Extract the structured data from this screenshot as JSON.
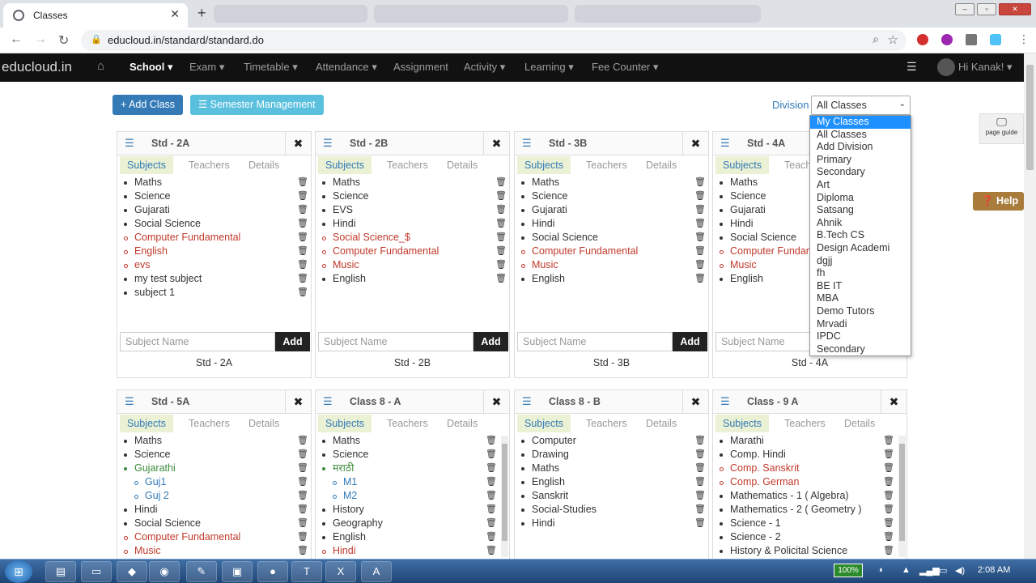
{
  "browser": {
    "tab_title": "Classes",
    "url": "educloud.in/standard/standard.do"
  },
  "navbar": {
    "brand": "educloud.in",
    "items": [
      "School ▾",
      "Exam ▾",
      "Timetable ▾",
      "Attendance ▾",
      "Assignment",
      "Activity ▾",
      "Learning ▾",
      "Fee Counter ▾"
    ],
    "user": "Hi Kanak! ▾"
  },
  "actions": {
    "add_class": "+ Add Class",
    "semester": "☰ Semester Management",
    "division_label": "Division",
    "division_value": "All Classes"
  },
  "division_options": [
    "My Classes",
    "All Classes",
    "Add Division",
    "Primary",
    "Secondary",
    "Art",
    "Diploma",
    "Satsang",
    "Ahnik",
    "B.Tech CS",
    "Design Academi",
    "dgjj",
    "fh",
    "BE IT",
    "MBA",
    "Demo Tutors",
    "Mrvadi",
    "IPDC",
    "Secondary"
  ],
  "page_guide": "page guide",
  "help": "Help",
  "card_tabs": [
    "Subjects",
    "Teachers",
    "Details"
  ],
  "subject_placeholder": "Subject Name",
  "add_label": "Add",
  "cards": [
    {
      "name": "Std - 2A",
      "footer": "Std - 2A",
      "subjects": [
        {
          "t": "Maths",
          "k": "n"
        },
        {
          "t": "Science",
          "k": "n"
        },
        {
          "t": "Gujarati",
          "k": "n"
        },
        {
          "t": "Social Science",
          "k": "n"
        },
        {
          "t": "Computer Fundamental",
          "k": "o"
        },
        {
          "t": "English",
          "k": "o"
        },
        {
          "t": "evs",
          "k": "o"
        },
        {
          "t": "my test subject",
          "k": "n"
        },
        {
          "t": "subject 1",
          "k": "n"
        }
      ]
    },
    {
      "name": "Std - 2B",
      "footer": "Std - 2B",
      "subjects": [
        {
          "t": "Maths",
          "k": "n"
        },
        {
          "t": "Science",
          "k": "n"
        },
        {
          "t": "EVS",
          "k": "n"
        },
        {
          "t": "Hindi",
          "k": "n"
        },
        {
          "t": "Social Science_$",
          "k": "o"
        },
        {
          "t": "Computer Fundamental",
          "k": "o"
        },
        {
          "t": "Music",
          "k": "o"
        },
        {
          "t": "English",
          "k": "n"
        }
      ]
    },
    {
      "name": "Std - 3B",
      "footer": "Std - 3B",
      "subjects": [
        {
          "t": "Maths",
          "k": "n"
        },
        {
          "t": "Science",
          "k": "n"
        },
        {
          "t": "Gujarati",
          "k": "n"
        },
        {
          "t": "Hindi",
          "k": "n"
        },
        {
          "t": "Social Science",
          "k": "n"
        },
        {
          "t": "Computer Fundamental",
          "k": "o"
        },
        {
          "t": "Music",
          "k": "o"
        },
        {
          "t": "English",
          "k": "n"
        }
      ]
    },
    {
      "name": "Std - 4A",
      "footer": "Std - 4A",
      "subjects": [
        {
          "t": "Maths",
          "k": "n"
        },
        {
          "t": "Science",
          "k": "n"
        },
        {
          "t": "Gujarati",
          "k": "n"
        },
        {
          "t": "Hindi",
          "k": "n"
        },
        {
          "t": "Social Science",
          "k": "n"
        },
        {
          "t": "Computer Fundam",
          "k": "o"
        },
        {
          "t": "Music",
          "k": "o"
        },
        {
          "t": "English",
          "k": "n"
        }
      ]
    },
    {
      "name": "Std - 5A",
      "footer": "",
      "subjects": [
        {
          "t": "Maths",
          "k": "n"
        },
        {
          "t": "Science",
          "k": "n"
        },
        {
          "t": "Gujarathi",
          "k": "g"
        },
        {
          "t": "Guj1",
          "k": "s"
        },
        {
          "t": "Guj 2",
          "k": "s"
        },
        {
          "t": "Hindi",
          "k": "n"
        },
        {
          "t": "Social Science",
          "k": "n"
        },
        {
          "t": "Computer Fundamental",
          "k": "o"
        },
        {
          "t": "Music",
          "k": "o"
        }
      ]
    },
    {
      "name": "Class 8 - A",
      "footer": "",
      "scroll": true,
      "subjects": [
        {
          "t": "Maths",
          "k": "n"
        },
        {
          "t": "Science",
          "k": "n"
        },
        {
          "t": "मराठी",
          "k": "g"
        },
        {
          "t": "M1",
          "k": "s"
        },
        {
          "t": "M2",
          "k": "s"
        },
        {
          "t": "History",
          "k": "n"
        },
        {
          "t": "Geography",
          "k": "n"
        },
        {
          "t": "English",
          "k": "n"
        },
        {
          "t": "Hindi",
          "k": "o"
        }
      ]
    },
    {
      "name": "Class 8 - B",
      "footer": "",
      "subjects": [
        {
          "t": "Computer",
          "k": "n"
        },
        {
          "t": "Drawing",
          "k": "n"
        },
        {
          "t": "Maths",
          "k": "n"
        },
        {
          "t": "English",
          "k": "n"
        },
        {
          "t": "Sanskrit",
          "k": "n"
        },
        {
          "t": "Social-Studies",
          "k": "n"
        },
        {
          "t": "Hindi",
          "k": "n"
        }
      ]
    },
    {
      "name": "Class - 9 A",
      "footer": "",
      "scroll": true,
      "subjects": [
        {
          "t": "Marathi",
          "k": "n"
        },
        {
          "t": "Comp. Hindi",
          "k": "n"
        },
        {
          "t": "Comp. Sanskrit",
          "k": "o"
        },
        {
          "t": "Comp. German",
          "k": "o"
        },
        {
          "t": "Mathematics - 1 ( Algebra)",
          "k": "n"
        },
        {
          "t": "Mathematics - 2 ( Geometry )",
          "k": "n"
        },
        {
          "t": "Science - 1",
          "k": "n"
        },
        {
          "t": "Science - 2",
          "k": "n"
        },
        {
          "t": "History & Policital Science",
          "k": "n"
        }
      ]
    }
  ],
  "taskbar": {
    "battery": "100%",
    "time": "2:08 AM"
  }
}
